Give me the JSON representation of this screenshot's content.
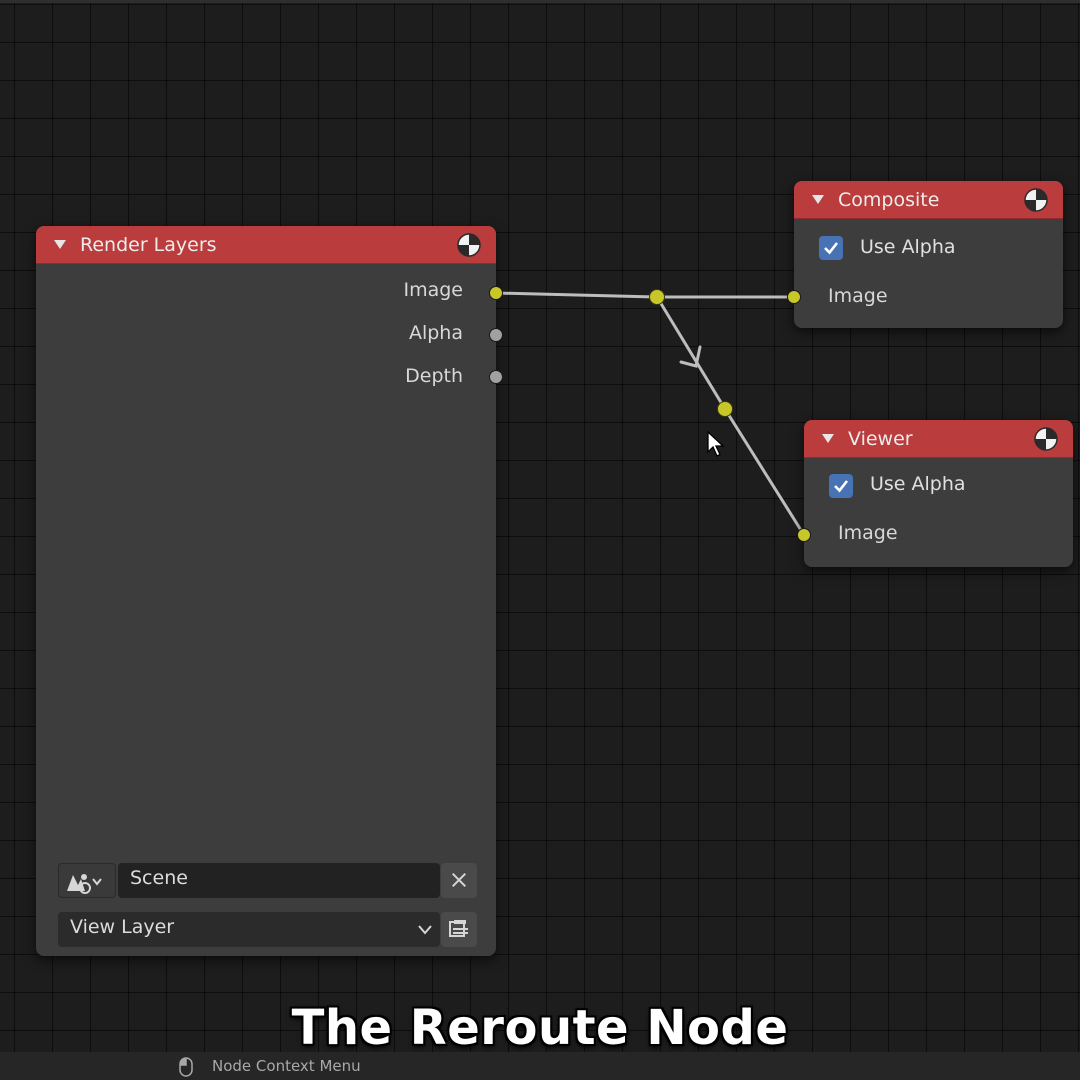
{
  "nodes": {
    "render_layers": {
      "title": "Render Layers",
      "outputs": [
        "Image",
        "Alpha",
        "Depth"
      ],
      "scene_value": "Scene",
      "view_layer_value": "View Layer"
    },
    "composite": {
      "title": "Composite",
      "use_alpha_label": "Use Alpha",
      "use_alpha_checked": true,
      "input_label": "Image"
    },
    "viewer": {
      "title": "Viewer",
      "use_alpha_label": "Use Alpha",
      "use_alpha_checked": true,
      "input_label": "Image"
    }
  },
  "caption": "The Reroute Node",
  "status_bar": {
    "mouse_icon": "mouse-icon",
    "text": "Node Context Menu"
  },
  "colors": {
    "node_header": "#ba3c3c",
    "node_body": "#3d3d3d",
    "image_socket": "#c7c729",
    "float_socket": "#a1a1a1",
    "checkbox": "#4772b3",
    "canvas": "#1d1d1d"
  }
}
